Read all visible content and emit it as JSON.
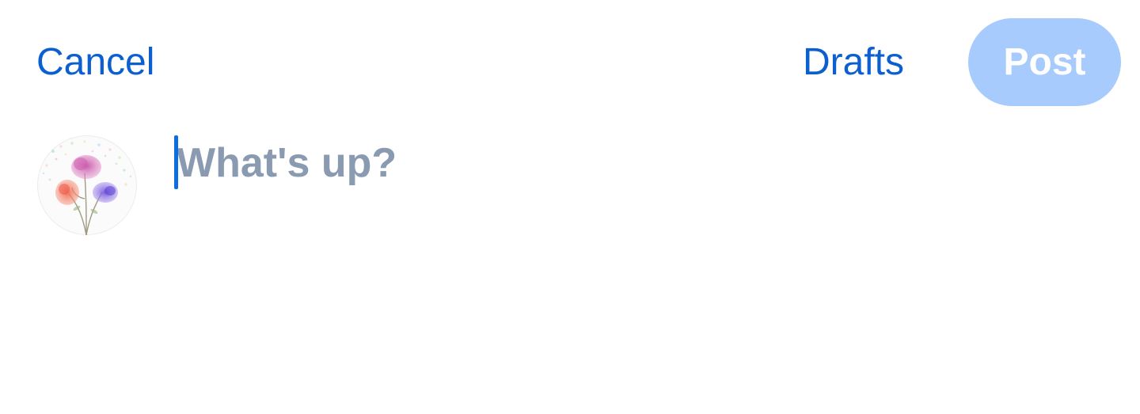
{
  "top_bar": {
    "cancel_label": "Cancel",
    "drafts_label": "Drafts",
    "post_label": "Post",
    "post_enabled": false
  },
  "composer": {
    "placeholder": "What's up?",
    "value": "",
    "avatar_icon": "watercolor-flowers-avatar-icon"
  },
  "colors": {
    "accent": "#0b5fcf",
    "post_disabled_bg": "#a7cbfc",
    "placeholder": "#8a9ab0",
    "caret": "#0b6de0"
  }
}
